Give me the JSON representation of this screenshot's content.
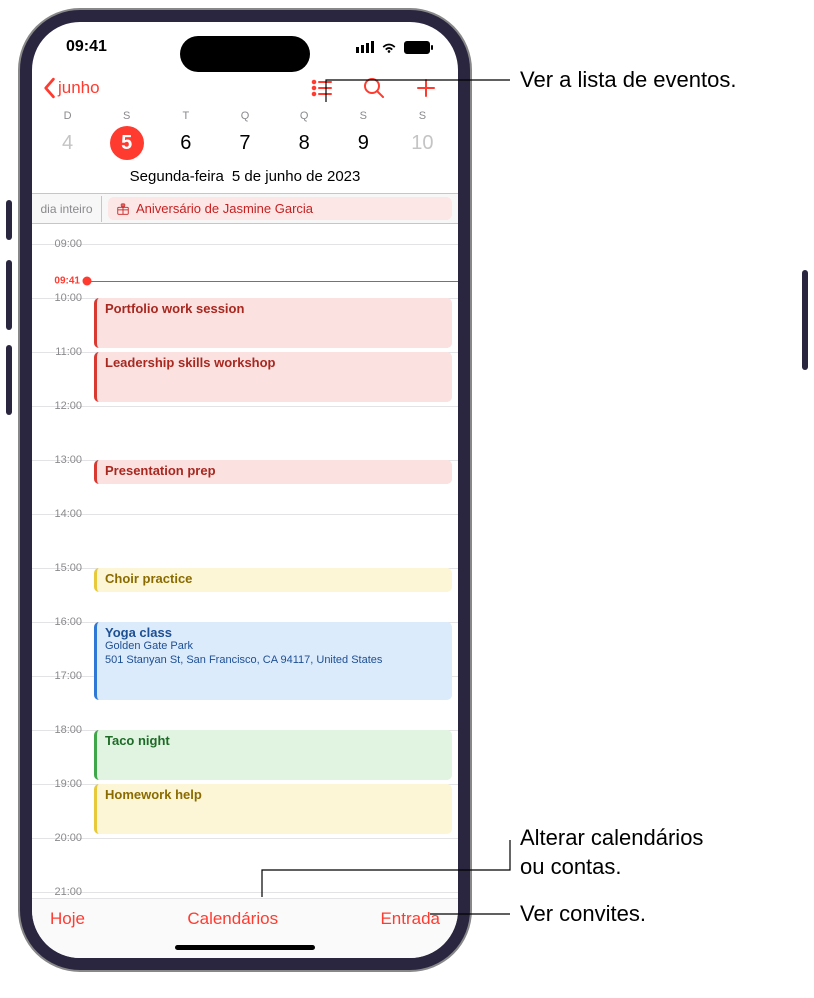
{
  "status": {
    "time": "09:41"
  },
  "nav": {
    "back_label": "junho"
  },
  "week": {
    "weekday_labels": [
      "D",
      "S",
      "T",
      "Q",
      "Q",
      "S",
      "S"
    ],
    "dates": [
      "4",
      "5",
      "6",
      "7",
      "8",
      "9",
      "10"
    ],
    "selected_index": 1,
    "muted_first": true,
    "muted_last": true,
    "day_of_week": "Segunda-feira",
    "full_date": "5 de junho de 2023"
  },
  "allday": {
    "label": "dia inteiro",
    "event_title": "Aniversário de Jasmine Garcia"
  },
  "timeline": {
    "hour_labels": [
      "09:00",
      "10:00",
      "11:00",
      "12:00",
      "13:00",
      "14:00",
      "15:00",
      "16:00",
      "17:00",
      "18:00",
      "19:00",
      "20:00",
      "21:00"
    ],
    "now_label": "09:41",
    "events": [
      {
        "title": "Portfolio work session"
      },
      {
        "title": "Leadership skills workshop"
      },
      {
        "title": "Presentation prep"
      },
      {
        "title": "Choir practice"
      },
      {
        "title": "Yoga class",
        "loc1": "Golden Gate Park",
        "loc2": "501 Stanyan St, San Francisco, CA 94117, United States"
      },
      {
        "title": "Taco night"
      },
      {
        "title": "Homework help"
      }
    ]
  },
  "toolbar": {
    "today": "Hoje",
    "calendars": "Calendários",
    "inbox": "Entrada"
  },
  "callouts": {
    "list": "Ver a lista de eventos.",
    "calendars_a": "Alterar calendários",
    "calendars_b": "ou contas.",
    "inbox": "Ver convites."
  }
}
